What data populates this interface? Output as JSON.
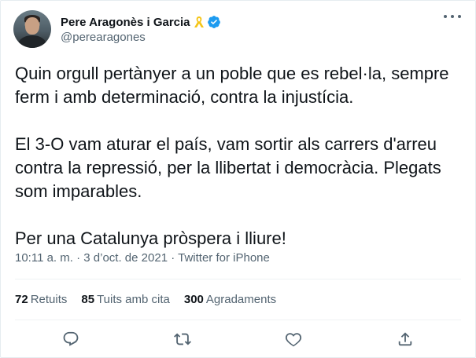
{
  "user": {
    "display_name": "Pere Aragonès i Garcia",
    "handle": "@perearagones",
    "ribbon_icon": "yellow-ribbon-icon",
    "verified_icon": "verified-badge-icon"
  },
  "tweet": {
    "paragraphs": [
      "Quin orgull pertànyer a un poble que es rebel·la, sempre ferm i amb determinació, contra la injustícia.",
      "El 3-O vam aturar el país, vam sortir als carrers d'arreu contra la repressió, per la llibertat i democràcia. Plegats som imparables.",
      "Per una Catalunya pròspera i lliure!"
    ],
    "time": "10:11 a. m.",
    "date": "3 d’oct. de 2021",
    "source": "Twitter for iPhone"
  },
  "stats": {
    "retweets_count": "72",
    "retweets_label": "Retuits",
    "quotes_count": "85",
    "quotes_label": "Tuits amb cita",
    "likes_count": "300",
    "likes_label": "Agradaments"
  },
  "colors": {
    "text_primary": "#0f1419",
    "text_secondary": "#536471",
    "verified_blue": "#1d9bf0",
    "ribbon_yellow": "#f5c518"
  }
}
